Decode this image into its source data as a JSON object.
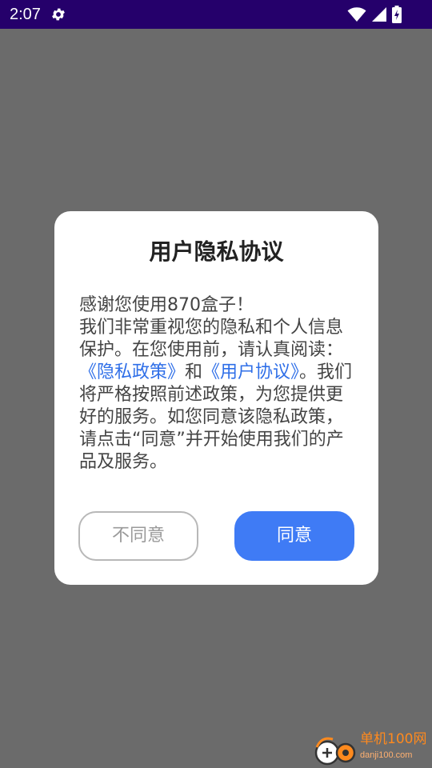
{
  "status_bar": {
    "time": "2:07",
    "icons": [
      "settings-icon",
      "wifi-icon",
      "signal-icon",
      "battery-charging-icon"
    ],
    "background": "#25006b"
  },
  "dialog": {
    "title": "用户隐私协议",
    "body": {
      "greeting": "感谢您使用870盒子！",
      "text_before_links": "我们非常重视您的隐私和个人信息保护。在您使用前，请认真阅读：",
      "privacy_policy_link": "《隐私政策》",
      "and": "和",
      "user_agreement_link": "《用户协议》",
      "text_after_links": "。我们将严格按照前述政策，为您提供更好的服务。如您同意该隐私政策，请点击“同意”并开始使用我们的产品及服务。"
    },
    "decline_button": "不同意",
    "agree_button": "同意",
    "link_color": "#2f6fe8",
    "accent_color": "#3f7bf5"
  },
  "watermark": {
    "brand": "单机100网",
    "url": "danji100.com"
  }
}
